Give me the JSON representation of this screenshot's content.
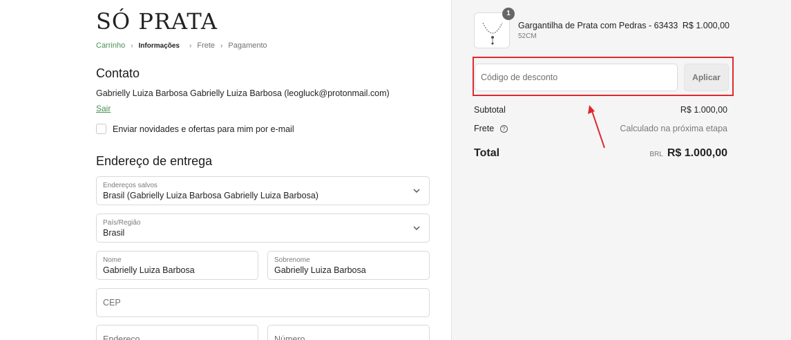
{
  "brand": {
    "logo": "SÓ PRATA"
  },
  "breadcrumb": [
    {
      "label": "Carrinho",
      "state": "done"
    },
    {
      "label": "Informações",
      "state": "current"
    },
    {
      "label": "Frete",
      "state": "pending"
    },
    {
      "label": "Pagamento",
      "state": "pending"
    }
  ],
  "contact": {
    "title": "Contato",
    "user_line": "Gabrielly Luiza Barbosa Gabrielly Luiza Barbosa (leogluck@protonmail.com)",
    "logout": "Sair",
    "newsletter_label": "Enviar novidades e ofertas para mim por e-mail"
  },
  "shipping": {
    "title": "Endereço de entrega",
    "saved_label": "Endereços salvos",
    "saved_value": "Brasil (Gabrielly Luiza Barbosa Gabrielly Luiza Barbosa)",
    "country_label": "País/Região",
    "country_value": "Brasil",
    "first_label": "Nome",
    "first_value": "Gabrielly Luiza Barbosa",
    "last_label": "Sobrenome",
    "last_value": "Gabrielly Luiza Barbosa",
    "cep_placeholder": "CEP",
    "address_placeholder": "Endereço",
    "number_placeholder": "Número"
  },
  "order": {
    "quantity": "1",
    "product_name": "Gargantilha de Prata com Pedras - 63433",
    "product_variant": "52CM",
    "product_price": "R$ 1.000,00",
    "discount_placeholder": "Código de desconto",
    "apply_label": "Aplicar",
    "subtotal_label": "Subtotal",
    "subtotal_value": "R$ 1.000,00",
    "shipping_label": "Frete",
    "shipping_value": "Calculado na próxima etapa",
    "total_label": "Total",
    "currency": "BRL",
    "total_value": "R$ 1.000,00"
  },
  "colors": {
    "accent": "#4a8f52",
    "highlight": "#e0282e"
  }
}
